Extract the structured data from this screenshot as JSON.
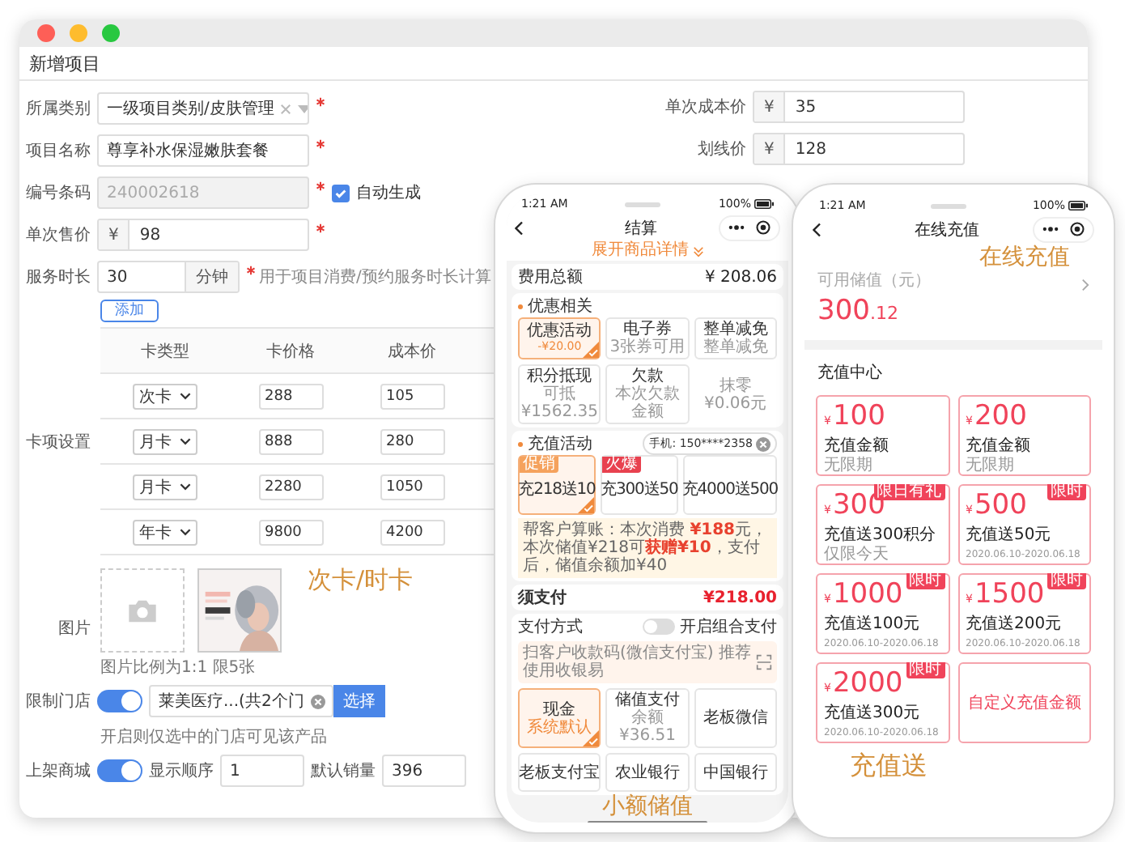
{
  "window": {
    "title": "新增项目"
  },
  "fields": [
    {
      "kind": "select",
      "label": "所属类别",
      "value": "一级项目类别/皮肤管理",
      "required": true
    },
    {
      "kind": "text",
      "label": "项目名称",
      "value": "尊享补水保湿嫩肤套餐",
      "required": true
    },
    {
      "kind": "code",
      "label": "编号条码",
      "value": "240002618",
      "required": true,
      "disabled": true,
      "checkbox": {
        "label": "自动生成",
        "checked": true
      }
    },
    {
      "kind": "price",
      "label": "单次售价",
      "prefix": "¥",
      "value": "98",
      "required": true
    },
    {
      "kind": "duration",
      "label": "服务时长",
      "value": "30",
      "suffix": "分钟",
      "required": true,
      "hint": "用于项目消费/预约服务时长计算"
    }
  ],
  "right_fields": [
    {
      "label": "单次成本价",
      "prefix": "¥",
      "value": "35"
    },
    {
      "label": "划线价",
      "prefix": "¥",
      "value": "128"
    }
  ],
  "card_settings": {
    "label": "卡项设置",
    "add_button": "添加",
    "columns": [
      "卡类型",
      "卡价格",
      "成本价"
    ],
    "rows": [
      {
        "type": "次卡",
        "price": "288",
        "cost": "105"
      },
      {
        "type": "月卡",
        "price": "888",
        "cost": "280"
      },
      {
        "type": "月卡",
        "price": "2280",
        "cost": "1050"
      },
      {
        "type": "年卡",
        "price": "9800",
        "cost": "4200"
      }
    ]
  },
  "images": {
    "label": "图片",
    "caption": "次卡/时卡",
    "hint": "图片比例为1:1 限5张"
  },
  "store_limit": {
    "label": "限制门店",
    "on": true,
    "value": "莱美医疗...(共2个门",
    "button": "选择",
    "hint": "开启则仅选中的门店可见该产品"
  },
  "shop": {
    "label": "上架商城",
    "on": true,
    "order_label": "显示顺序",
    "order": "1",
    "sales_label": "默认销量",
    "sales": "396"
  },
  "checkout_phone": {
    "time": "1:21 AM",
    "battery": "100%",
    "title": "结算",
    "expand": "展开商品详情",
    "total_label": "费用总额",
    "total": "¥ 208.06",
    "discount": {
      "title": "优惠相关",
      "options": [
        {
          "kind": "option",
          "name": "优惠活动",
          "note": "-¥20.00",
          "selected": true
        },
        {
          "kind": "option",
          "name": "电子券",
          "note": "3张券可用",
          "selected": false
        },
        {
          "kind": "option",
          "name": "整单减免",
          "note": "整单减免",
          "selected": false
        },
        {
          "kind": "option",
          "name": "积分抵现",
          "note": "可抵¥1562.35",
          "selected": false
        },
        {
          "kind": "option",
          "name": "欠款",
          "note": "本次欠款金额",
          "selected": false
        },
        {
          "kind": "plain",
          "name": "抹零 ¥0.06元"
        }
      ]
    },
    "recharge": {
      "title": "充值活动",
      "phone": "手机: 150****2358",
      "options": [
        {
          "tag": {
            "text": "促销",
            "color": "#f5a25d"
          },
          "name": "充218送10",
          "selected": true
        },
        {
          "tag": {
            "text": "火爆",
            "color": "#e8414f"
          },
          "name": "充300送50",
          "selected": false
        },
        {
          "name": "充4000送500",
          "selected": false
        }
      ],
      "note": "帮客户算账：本次消费 **¥188**元，本次储值¥218可**获赠¥10**，支付后，储值余额加¥40"
    },
    "due_label": "须支付",
    "due": "¥218.00",
    "pay_method_label": "支付方式",
    "combo": {
      "label": "开启组合支付",
      "on": false
    },
    "scan_hint": "扫客户收款码(微信支付宝) 推荐使用收银易",
    "payments": [
      {
        "name": "现金",
        "note": "系统默认",
        "selected": true
      },
      {
        "name": "储值支付",
        "note": "余额¥36.51",
        "selected": false
      },
      {
        "name": "老板微信",
        "selected": false
      },
      {
        "name": "老板支付宝",
        "selected": false
      },
      {
        "name": "农业银行",
        "selected": false
      },
      {
        "name": "中国银行",
        "selected": false
      }
    ],
    "caption": "小额储值"
  },
  "recharge_phone": {
    "time": "1:21 AM",
    "battery": "100%",
    "title": "在线充值",
    "caption": "在线充值",
    "balance_label": "可用储值（元）",
    "balance_int": "300",
    "balance_dec": ".12",
    "center_title": "充值中心",
    "packages": [
      {
        "kind": "amount",
        "currency": "¥",
        "amount": "100",
        "name": "充值金额",
        "note": "无限期"
      },
      {
        "kind": "amount",
        "currency": "¥",
        "amount": "200",
        "name": "充值金额",
        "note": "无限期"
      },
      {
        "kind": "amount",
        "currency": "¥",
        "amount": "300",
        "name": "充值送300积分",
        "note": "仅限今天",
        "badge": "限日有礼"
      },
      {
        "kind": "amount",
        "currency": "¥",
        "amount": "500",
        "name": "充值送50元",
        "note": "2020.06.10-2020.06.18",
        "badge": "限时"
      },
      {
        "kind": "amount",
        "currency": "¥",
        "amount": "1000",
        "name": "充值送100元",
        "note": "2020.06.10-2020.06.18",
        "badge": "限时"
      },
      {
        "kind": "amount",
        "currency": "¥",
        "amount": "1500",
        "name": "充值送200元",
        "note": "2020.06.10-2020.06.18",
        "badge": "限时"
      },
      {
        "kind": "amount",
        "currency": "¥",
        "amount": "2000",
        "name": "充值送300元",
        "note": "2020.06.10-2020.06.18",
        "badge": "限时"
      },
      {
        "kind": "custom",
        "name": "自定义充值金额"
      }
    ],
    "footer_caption": "充值送"
  }
}
